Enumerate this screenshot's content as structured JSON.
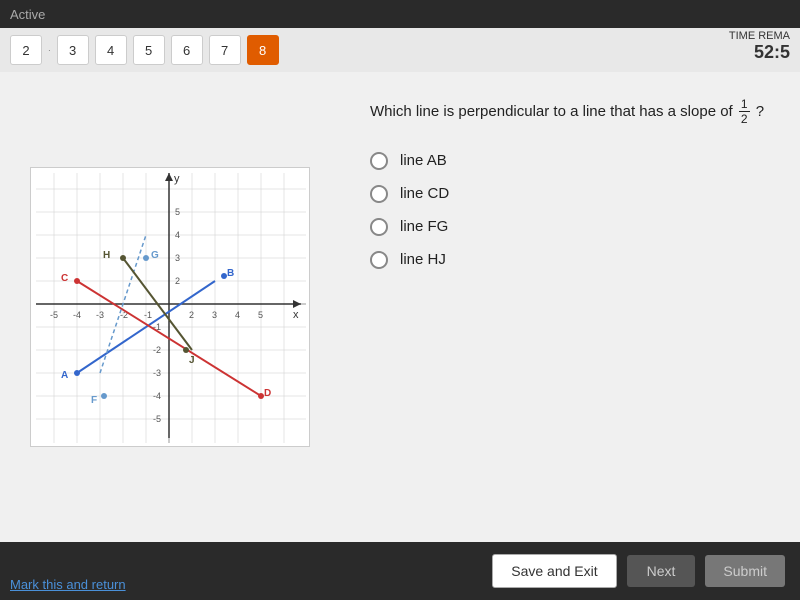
{
  "topbar": {
    "active_label": "Active"
  },
  "navbar": {
    "questions": [
      {
        "number": "2",
        "active": false
      },
      {
        "number": "3",
        "active": false
      },
      {
        "number": "4",
        "active": false
      },
      {
        "number": "5",
        "active": false
      },
      {
        "number": "6",
        "active": false
      },
      {
        "number": "7",
        "active": false
      },
      {
        "number": "8",
        "active": true
      }
    ],
    "time_label": "TIME REMA",
    "time_value": "52:5"
  },
  "question": {
    "text_before": "Which line is perpendicular to a line that has a slope of",
    "fraction_numerator": "1",
    "fraction_denominator": "2",
    "text_after": "?",
    "options": [
      {
        "id": "AB",
        "label": "line AB"
      },
      {
        "id": "CD",
        "label": "line CD"
      },
      {
        "id": "FG",
        "label": "line FG"
      },
      {
        "id": "HJ",
        "label": "line HJ"
      }
    ]
  },
  "graph": {
    "x_label": "x",
    "y_label": "y",
    "point_labels": [
      "A",
      "B",
      "C",
      "D",
      "F",
      "G",
      "H",
      "J"
    ]
  },
  "buttons": {
    "save_exit": "Save and Exit",
    "next": "Next",
    "submit": "Submit"
  },
  "footer": {
    "mark_return": "Mark this and return"
  }
}
